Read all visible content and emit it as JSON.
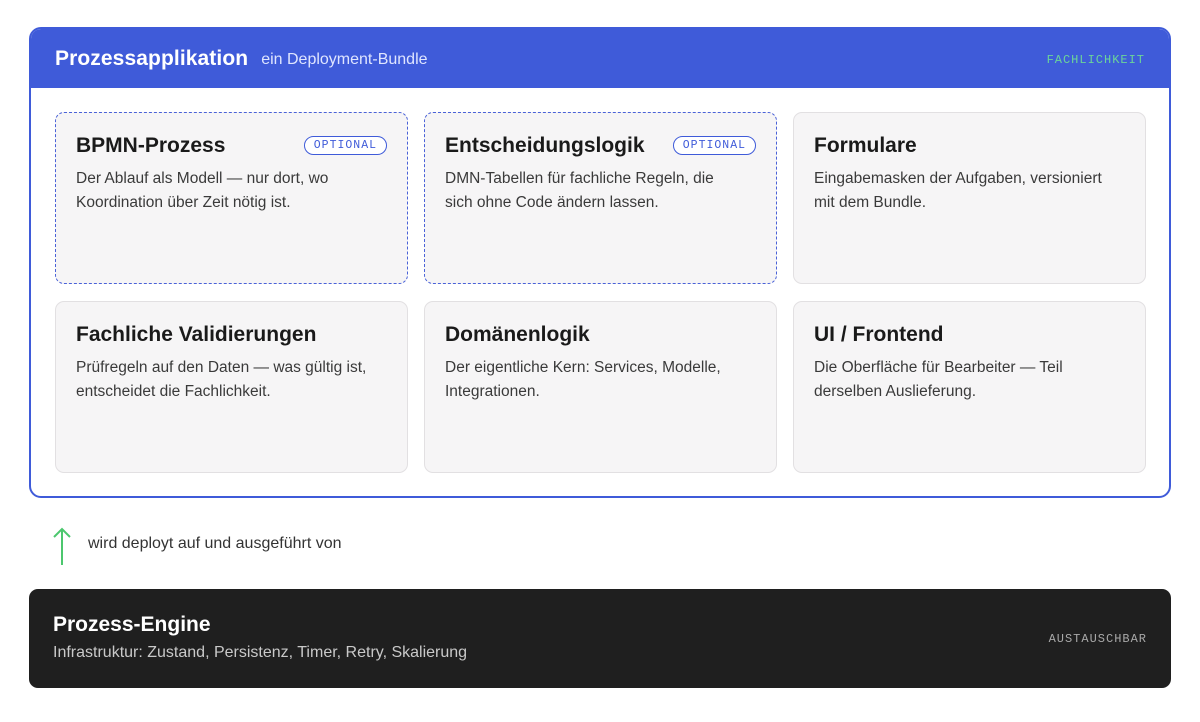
{
  "app": {
    "title": "Prozessapplikation",
    "subtitle": "ein Deployment-Bundle",
    "tag": "FACHLICHKEIT"
  },
  "cards": [
    {
      "title": "BPMN-Prozess",
      "badge": "OPTIONAL",
      "description": "Der Ablauf als Modell — nur dort, wo Koordination über Zeit nötig ist."
    },
    {
      "title": "Entscheidungslogik",
      "badge": "OPTIONAL",
      "description": "DMN-Tabellen für fachliche Regeln, die sich ohne Code ändern lassen."
    },
    {
      "title": "Formulare",
      "description": "Eingabemasken der Aufgaben, versioniert mit dem Bundle."
    },
    {
      "title": "Fachliche Validierungen",
      "description": "Prüfregeln auf den Daten — was gültig ist, entscheidet die Fachlichkeit."
    },
    {
      "title": "Domänenlogik",
      "description": "Der eigentliche Kern: Services, Modelle, Integrationen."
    },
    {
      "title": "UI / Frontend",
      "description": "Die Oberfläche für Bearbeiter — Teil derselben Auslieferung."
    }
  ],
  "connector": {
    "label": "wird deployt auf und ausgeführt von",
    "icon": "arrow-up-icon",
    "color": "#4cc76e"
  },
  "engine": {
    "title": "Prozess-Engine",
    "description": "Infrastruktur: Zustand, Persistenz, Timer, Retry, Skalierung",
    "tag": "AUSTAUSCHBAR"
  },
  "colors": {
    "accent": "#3f5bd9",
    "engine_bg": "#1f1f1f",
    "card_bg": "#f6f5f6",
    "tag_green": "#6bd49a"
  }
}
